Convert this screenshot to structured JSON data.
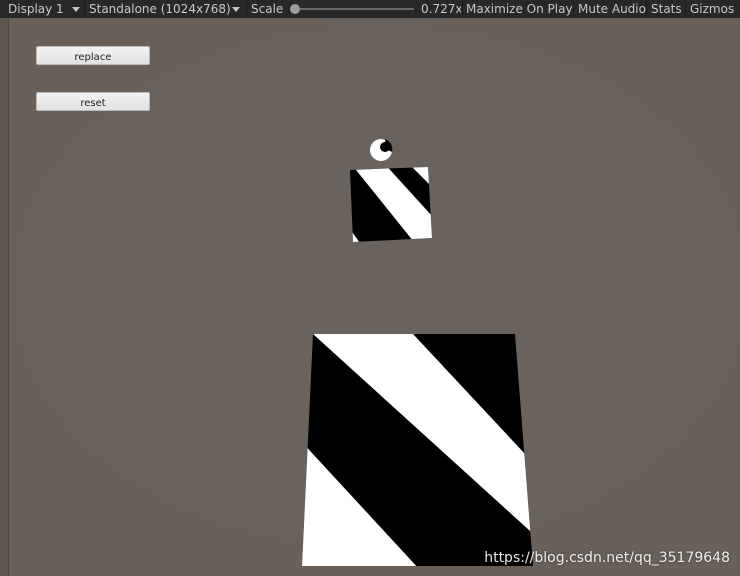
{
  "toolbar": {
    "display": "Display 1",
    "resolution": "Standalone (1024x768)",
    "scale_label": "Scale",
    "scale_value": "0.727x",
    "maximize": "Maximize On Play",
    "mute": "Mute Audio",
    "stats": "Stats",
    "gizmos": "Gizmos"
  },
  "buttons": {
    "replace": "replace",
    "reset": "reset"
  },
  "watermark": "https://blog.csdn.net/qq_35179648",
  "colors": {
    "background": "#686059",
    "toolbar": "#282828",
    "stripe_dark": "#000000",
    "stripe_light": "#ffffff"
  }
}
